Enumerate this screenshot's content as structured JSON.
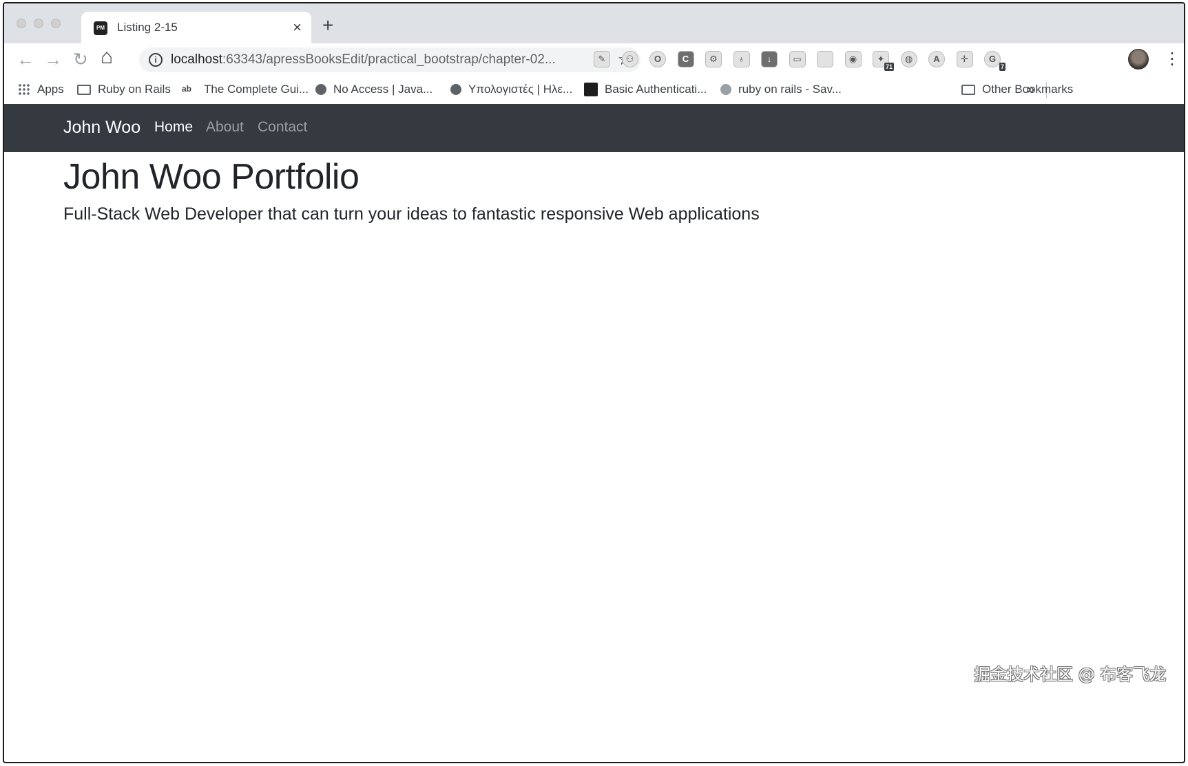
{
  "browser": {
    "tab": {
      "title": "Listing 2-15",
      "favicon_label": "PM",
      "close_glyph": "×"
    },
    "new_tab_glyph": "+",
    "nav": {
      "back_glyph": "←",
      "forward_glyph": "→",
      "reload_glyph": "↻",
      "home_glyph": "⌂"
    },
    "address": {
      "host": "localhost",
      "rest": ":63343/apressBooksEdit/practical_bootstrap/chapter-02...",
      "info_glyph": "i",
      "star_glyph": "☆"
    },
    "extensions": [
      {
        "name": "eyedropper-ext-icon",
        "glyph": "✎"
      },
      {
        "name": "network-ext-icon",
        "glyph": "⚇"
      },
      {
        "name": "opera-ext-icon",
        "glyph": "O"
      },
      {
        "name": "c-ext-icon",
        "glyph": "C"
      },
      {
        "name": "gear-ext-icon",
        "glyph": "⚙"
      },
      {
        "name": "lightbulb-ext-icon",
        "glyph": "♁"
      },
      {
        "name": "download-ext-icon",
        "glyph": "↓"
      },
      {
        "name": "image-ext-icon",
        "glyph": "▭"
      },
      {
        "name": "blank-ext-icon",
        "glyph": ""
      },
      {
        "name": "camera-ext-icon",
        "glyph": "◉"
      },
      {
        "name": "tag-ext-icon",
        "glyph": "✦",
        "badge": "71"
      },
      {
        "name": "translate-ext-icon",
        "glyph": "◍"
      },
      {
        "name": "a-ext-icon",
        "glyph": "A"
      },
      {
        "name": "move-ext-icon",
        "glyph": "✛"
      },
      {
        "name": "g-ext-icon",
        "glyph": "G",
        "badge": "7"
      }
    ],
    "menu_glyph": "⋮",
    "bookmarks": {
      "items": [
        {
          "label": "Apps"
        },
        {
          "label": "Ruby on Rails"
        },
        {
          "label": "The Complete Gui..."
        },
        {
          "label": "No Access | Java..."
        },
        {
          "label": "Υπολογιστές | Ηλε..."
        },
        {
          "label": "Basic Authenticati..."
        },
        {
          "label": "ruby on rails - Sav..."
        }
      ],
      "ab_icon_text": "ab",
      "overflow_glyph": "»",
      "other": "Other Bookmarks"
    }
  },
  "page": {
    "navbar": {
      "brand": "John Woo",
      "links": [
        {
          "label": "Home",
          "active": true
        },
        {
          "label": "About",
          "active": false
        },
        {
          "label": "Contact",
          "active": false
        }
      ]
    },
    "title": "John Woo Portfolio",
    "lead": "Full-Stack Web Developer that can turn your ideas to fantastic responsive Web applications"
  },
  "watermark": "掘金技术社区 @ 布客飞龙"
}
